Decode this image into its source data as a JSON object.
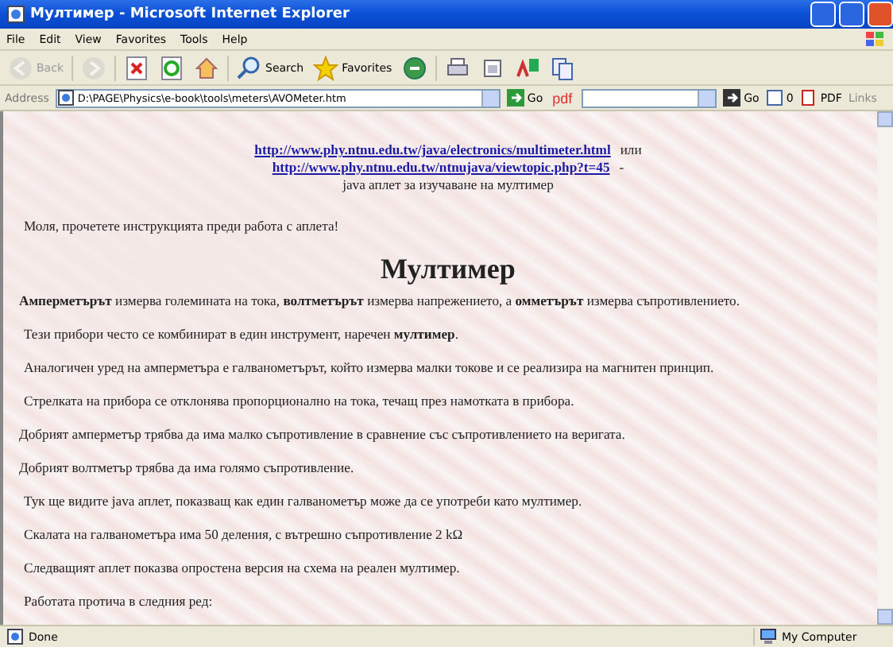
{
  "window": {
    "title": "Мултимер - Microsoft Internet Explorer"
  },
  "menu": [
    "File",
    "Edit",
    "View",
    "Favorites",
    "Tools",
    "Help"
  ],
  "toolbar": [
    {
      "kind": "back",
      "label": "Back",
      "disabled": true
    },
    {
      "kind": "forward",
      "disabled": true
    },
    {
      "kind": "stop",
      "disabled": false
    },
    {
      "kind": "refresh",
      "disabled": false
    },
    {
      "kind": "home",
      "disabled": false
    },
    {
      "kind": "search",
      "label": "Search",
      "disabled": false
    },
    {
      "kind": "favorites",
      "label": "Favorites",
      "disabled": false
    },
    {
      "kind": "media",
      "disabled": false
    },
    {
      "kind": "print",
      "disabled": false
    },
    {
      "kind": "edit",
      "disabled": false
    },
    {
      "kind": "translate",
      "disabled": false
    },
    {
      "kind": "copy",
      "disabled": false
    }
  ],
  "address_bar": {
    "label": "Address",
    "value": "D:\\PAGE\\Physics\\e-book\\tools\\meters\\AVOMeter.htm",
    "go": "Go",
    "pdf": "pdf",
    "go2": "Go",
    "count": "0",
    "pdf_button": "PDF",
    "links": "Links"
  },
  "page": {
    "link_1": "http://www.phy.ntnu.edu.tw/java/electronics/multimeter.html",
    "or": "или",
    "link_2": "http://www.phy.ntnu.edu.tw/ntnujava/viewtopic.php?t=45",
    "dash": "-",
    "caption": "java аплет за изучаване на мултимер",
    "intro": "Моля, прочетете инструкцията преди работа с аплета!",
    "heading": "Мултимер",
    "paragraphs": [
      {
        "text": "**Амперметърът** измерва големината на тока, **волтметърът** измерва напрежението, а **омметърът** измерва съпротивлението.",
        "indented": false
      },
      {
        "text": "Тези прибори често се комбинират в един инструмент, наречен **мултимер**.",
        "indented": true
      },
      {
        "text": "Аналогичен уред на амперметъра е галванометърът, който измерва малки токове и се реализира на магнитен принцип.",
        "indented": true
      },
      {
        "text": "Стрелката на прибора се отклонява пропорционално на тока, течащ през намотката в прибора.",
        "indented": true
      },
      {
        "text": "Добрият амперметър трябва да има малко съпротивление в сравнение със съпротивлението на веригата.",
        "indented": false
      },
      {
        "text": "Добрият волтметър трябва да има голямо съпротивление.",
        "indented": false
      },
      {
        "text": "Тук ще видите java аплет, показващ как един галванометър може да се употреби като мултимер.",
        "indented": true
      },
      {
        "text": "Скалата на галванометъра има 50 деления, с вътрешно съпротивление 2 kΩ",
        "indented": true
      },
      {
        "text": "Следващият аплет показва опростена версия на схема на реален мултимер.",
        "indented": true
      },
      {
        "text": "Работата протича в следния ред:",
        "indented": true
      }
    ]
  },
  "status_bar": {
    "text": "Done",
    "zone": "My Computer"
  }
}
